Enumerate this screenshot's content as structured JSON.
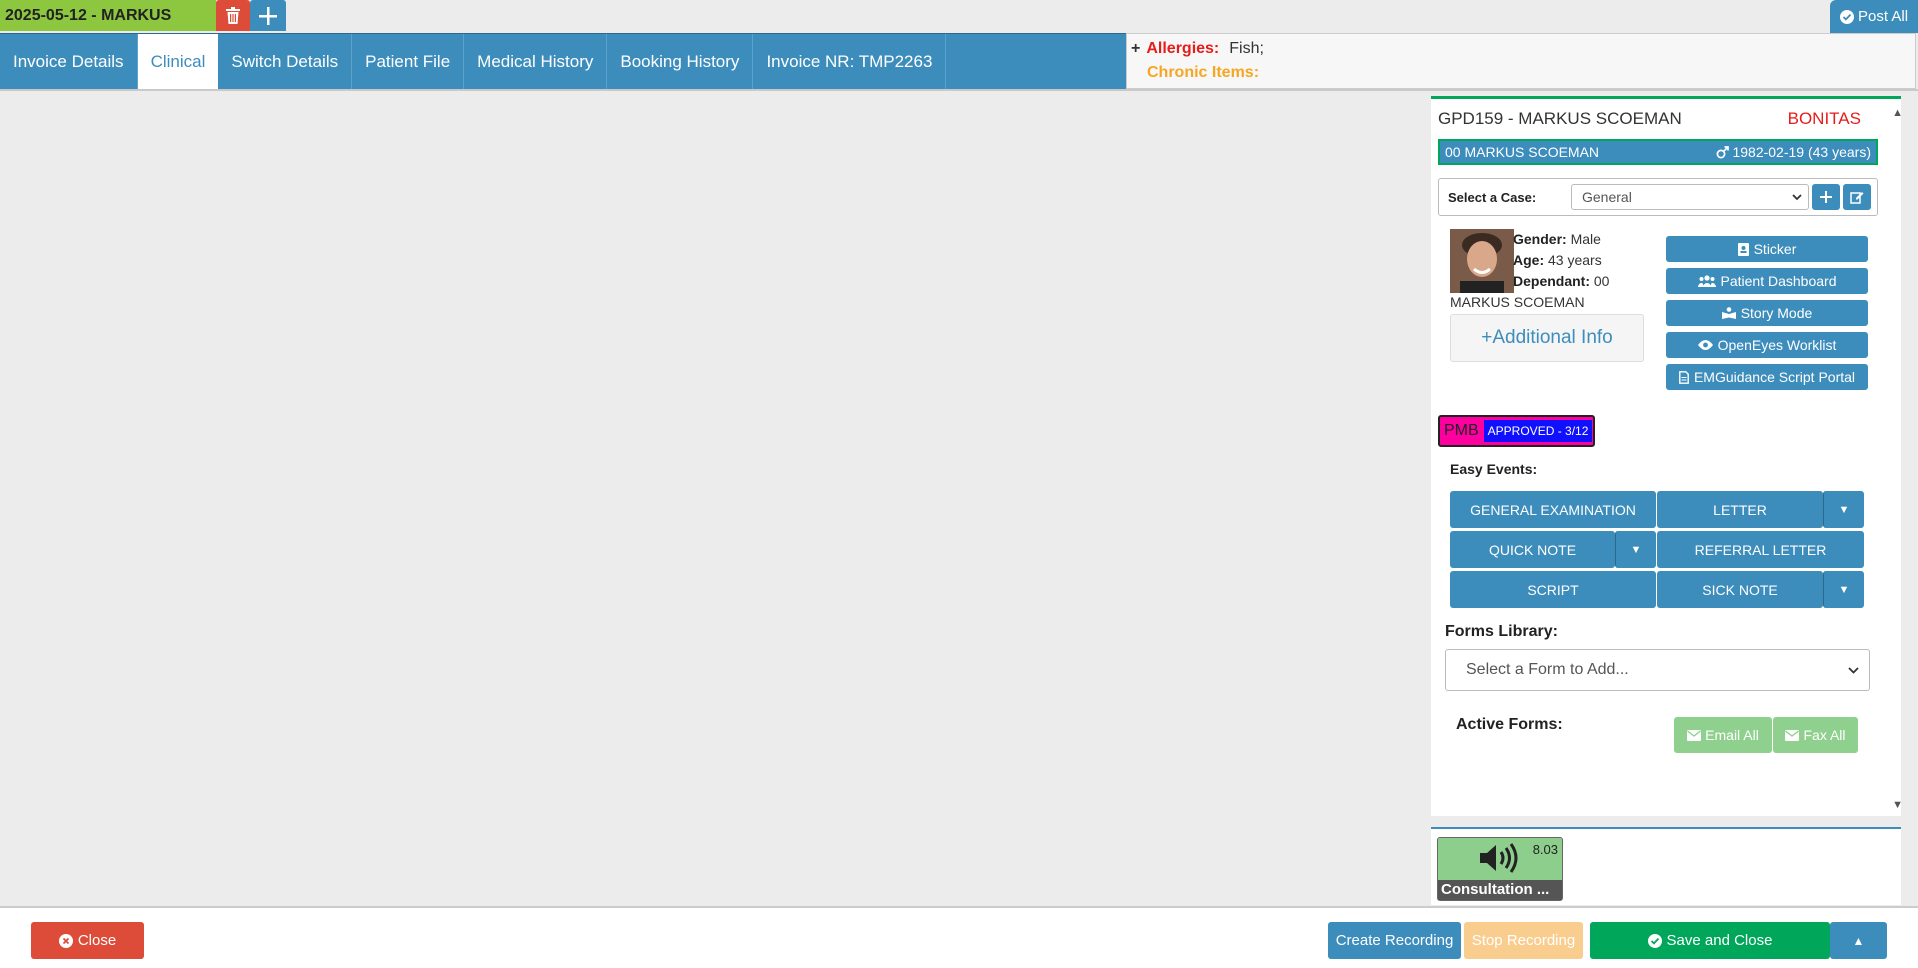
{
  "topbar": {
    "session_label": "2025-05-12 - MARKUS",
    "delete_icon": "trash-icon",
    "add_icon": "plus-icon",
    "post_all": "Post All"
  },
  "nav": {
    "tabs": [
      {
        "label": "Invoice Details",
        "active": false
      },
      {
        "label": "Clinical",
        "active": true
      },
      {
        "label": "Switch Details",
        "active": false
      },
      {
        "label": "Patient File",
        "active": false
      },
      {
        "label": "Medical History",
        "active": false
      },
      {
        "label": "Booking History",
        "active": false
      },
      {
        "label": "Invoice NR: TMP2263",
        "active": false
      }
    ]
  },
  "alerts": {
    "allergies_label": "Allergies:",
    "allergies_value": "Fish;",
    "chronic_label": "Chronic Items:",
    "chronic_value": ""
  },
  "patient": {
    "header": "GPD159 - MARKUS SCOEMAN",
    "fund": "BONITAS",
    "strip_name": "00 MARKUS SCOEMAN",
    "strip_dob": "1982-02-19 (43 years)",
    "gender_label": "Gender:",
    "gender": "Male",
    "age_label": "Age:",
    "age": "43 years",
    "dependant_label": "Dependant:",
    "dependant": "00",
    "dependant_name": "MARKUS SCOEMAN",
    "additional_info": "+Additional Info"
  },
  "case": {
    "label": "Select a Case:",
    "selected": "General"
  },
  "side_buttons": [
    {
      "label": "Sticker",
      "icon": "id-card-icon"
    },
    {
      "label": "Patient Dashboard",
      "icon": "users-icon"
    },
    {
      "label": "Story Mode",
      "icon": "book-reader-icon"
    },
    {
      "label": "OpenEyes Worklist",
      "icon": "eye-icon"
    },
    {
      "label": "EMGuidance Script Portal",
      "icon": "file-icon"
    }
  ],
  "pmb": {
    "label": "PMB",
    "status": "APPROVED - 3/12"
  },
  "easy_events": {
    "label": "Easy Events:",
    "general_examination": "GENERAL EXAMINATION",
    "letter": "LETTER",
    "quick_note": "QUICK NOTE",
    "referral_letter": "REFERRAL LETTER",
    "script": "SCRIPT",
    "sick_note": "SICK NOTE"
  },
  "forms": {
    "library_label": "Forms Library:",
    "select_placeholder": "Select a Form to Add...",
    "active_label": "Active Forms:",
    "email_all": "Email All",
    "fax_all": "Fax All"
  },
  "consultation": {
    "duration": "8.03",
    "name": "Consultation ...",
    "icon": "volume-icon"
  },
  "bottom": {
    "close": "Close",
    "create_recording": "Create Recording",
    "stop_recording": "Stop Recording",
    "save_and_close": "Save and Close"
  },
  "colors": {
    "primary": "#3c8dbc",
    "success": "#00a65a",
    "danger": "#dd4b39",
    "session_green": "#8dc63f",
    "pmb_pink": "#ff00a0"
  }
}
